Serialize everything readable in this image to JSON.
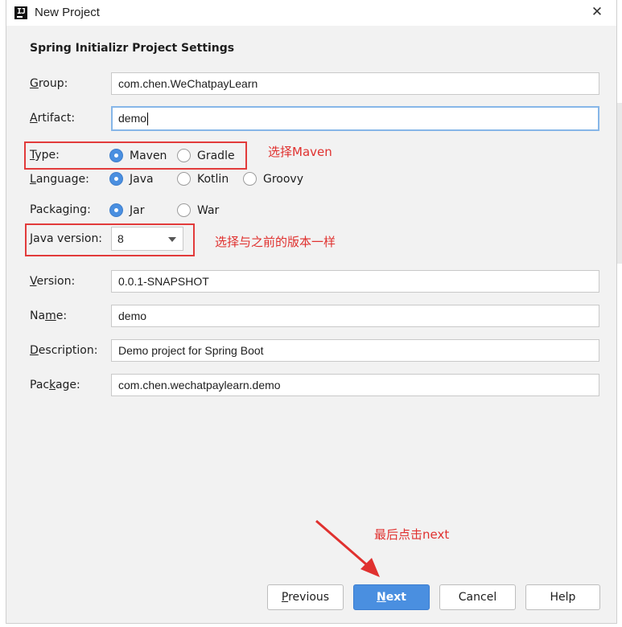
{
  "window": {
    "title": "New Project",
    "close_icon": "close-icon",
    "app_icon_letter": "IJ"
  },
  "section_title": "Spring Initializr Project Settings",
  "fields": {
    "group": {
      "label_mnemonic": "G",
      "label_rest": "roup:",
      "value": "com.chen.WeChatpayLearn"
    },
    "artifact": {
      "label_mnemonic": "A",
      "label_rest": "rtifact:",
      "value": "demo"
    },
    "version": {
      "label_mnemonic": "V",
      "label_rest": "ersion:",
      "value": "0.0.1-SNAPSHOT"
    },
    "name": {
      "label_pre": "Na",
      "label_mnemonic": "m",
      "label_rest": "e:",
      "value": "demo"
    },
    "description": {
      "label_mnemonic": "D",
      "label_rest": "escription:",
      "value": "Demo project for Spring Boot"
    },
    "package": {
      "label_pre": "Pac",
      "label_mnemonic": "k",
      "label_rest": "age:",
      "value": "com.chen.wechatpaylearn.demo"
    }
  },
  "type": {
    "label_mnemonic": "T",
    "label_rest": "ype:",
    "options": [
      "Maven",
      "Gradle"
    ],
    "selected": "Maven"
  },
  "language": {
    "label_mnemonic": "L",
    "label_rest": "anguage:",
    "options": [
      "Java",
      "Kotlin",
      "Groovy"
    ],
    "selected": "Java"
  },
  "packaging": {
    "label_pre": "Packa",
    "label_mnemonic": "g",
    "label_rest": "ing:",
    "options": [
      "Jar",
      "War"
    ],
    "selected": "Jar"
  },
  "java_version": {
    "label_mnemonic": "J",
    "label_rest": "ava version:",
    "value": "8"
  },
  "annotations": {
    "type_note": "选择Maven",
    "java_note": "选择与之前的版本一样",
    "next_note": "最后点击next",
    "color": "#e0312f"
  },
  "buttons": {
    "previous": {
      "mnemonic": "P",
      "rest": "revious"
    },
    "next": {
      "mnemonic": "N",
      "rest": "ext"
    },
    "cancel": "Cancel",
    "help": "Help"
  },
  "colors": {
    "accent": "#4a8fe0",
    "focus_border": "#86b6e8",
    "dialog_bg": "#f2f2f2"
  }
}
